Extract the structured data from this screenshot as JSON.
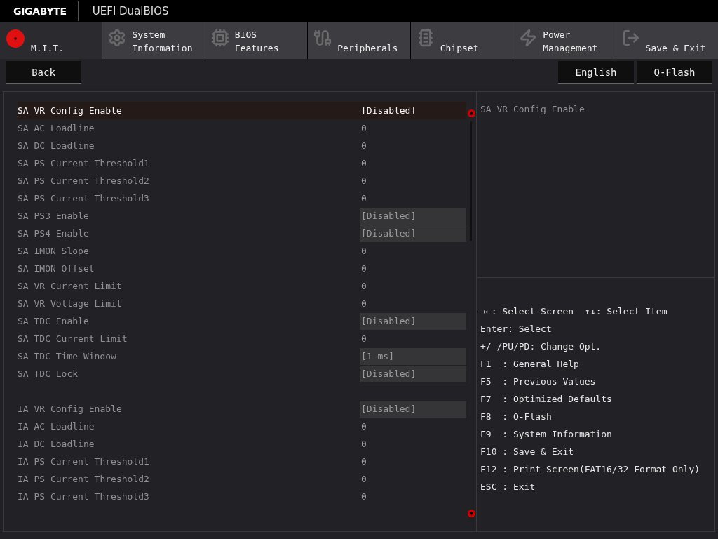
{
  "header": {
    "brand": "GIGABYTE",
    "title": "UEFI DualBIOS"
  },
  "tabs": [
    {
      "lines": [
        "M.I.T."
      ],
      "selected": true
    },
    {
      "lines": [
        "System",
        "Information"
      ],
      "selected": false
    },
    {
      "lines": [
        "BIOS",
        "Features"
      ],
      "selected": false
    },
    {
      "lines": [
        "Peripherals"
      ],
      "selected": false
    },
    {
      "lines": [
        "Chipset"
      ],
      "selected": false
    },
    {
      "lines": [
        "Power",
        "Management"
      ],
      "selected": false
    },
    {
      "lines": [
        "Save & Exit"
      ],
      "selected": false
    }
  ],
  "toolbar": {
    "back": "Back",
    "buttons": [
      "English",
      "Q-Flash"
    ]
  },
  "groups": [
    [
      {
        "label": "SA VR Config Enable",
        "value": "[Disabled]",
        "kind": "option",
        "selected": true
      },
      {
        "label": "SA AC Loadline",
        "value": "0",
        "kind": "number",
        "selected": false
      },
      {
        "label": "SA DC Loadline",
        "value": "0",
        "kind": "number",
        "selected": false
      },
      {
        "label": "SA PS Current Threshold1",
        "value": "0",
        "kind": "number",
        "selected": false
      },
      {
        "label": "SA PS Current Threshold2",
        "value": "0",
        "kind": "number",
        "selected": false
      },
      {
        "label": "SA PS Current Threshold3",
        "value": "0",
        "kind": "number",
        "selected": false
      },
      {
        "label": "SA PS3 Enable",
        "value": "[Disabled]",
        "kind": "option",
        "selected": false
      },
      {
        "label": "SA PS4 Enable",
        "value": "[Disabled]",
        "kind": "option",
        "selected": false
      },
      {
        "label": "SA IMON Slope",
        "value": "0",
        "kind": "number",
        "selected": false
      },
      {
        "label": "SA IMON Offset",
        "value": "0",
        "kind": "number",
        "selected": false
      },
      {
        "label": "SA VR Current Limit",
        "value": "0",
        "kind": "number",
        "selected": false
      },
      {
        "label": "SA VR Voltage Limit",
        "value": "0",
        "kind": "number",
        "selected": false
      },
      {
        "label": "SA TDC Enable",
        "value": "[Disabled]",
        "kind": "option",
        "selected": false
      },
      {
        "label": "SA TDC Current Limit",
        "value": "0",
        "kind": "number",
        "selected": false
      },
      {
        "label": "SA TDC Time Window",
        "value": "[1 ms]",
        "kind": "option",
        "selected": false
      },
      {
        "label": "SA TDC Lock",
        "value": "[Disabled]",
        "kind": "option",
        "selected": false
      }
    ],
    [
      {
        "label": "IA VR Config Enable",
        "value": "[Disabled]",
        "kind": "option",
        "selected": false
      },
      {
        "label": "IA AC Loadline",
        "value": "0",
        "kind": "number",
        "selected": false
      },
      {
        "label": "IA DC Loadline",
        "value": "0",
        "kind": "number",
        "selected": false
      },
      {
        "label": "IA PS Current Threshold1",
        "value": "0",
        "kind": "number",
        "selected": false
      },
      {
        "label": "IA PS Current Threshold2",
        "value": "0",
        "kind": "number",
        "selected": false
      },
      {
        "label": "IA PS Current Threshold3",
        "value": "0",
        "kind": "number",
        "selected": false
      }
    ]
  ],
  "help": {
    "description": "SA VR Config Enable",
    "keys": [
      [
        "→←: Select Screen",
        "↑↓: Select Item"
      ],
      [
        "Enter: Select"
      ],
      [
        "+/-/PU/PD: Change Opt."
      ],
      [
        "F1  : General Help"
      ],
      [
        "F5  : Previous Values"
      ],
      [
        "F7  : Optimized Defaults"
      ],
      [
        "F8  : Q-Flash"
      ],
      [
        "F9  : System Information"
      ],
      [
        "F10 : Save & Exit"
      ],
      [
        "F12 : Print Screen(FAT16/32 Format Only)"
      ],
      [
        "ESC : Exit"
      ]
    ]
  }
}
